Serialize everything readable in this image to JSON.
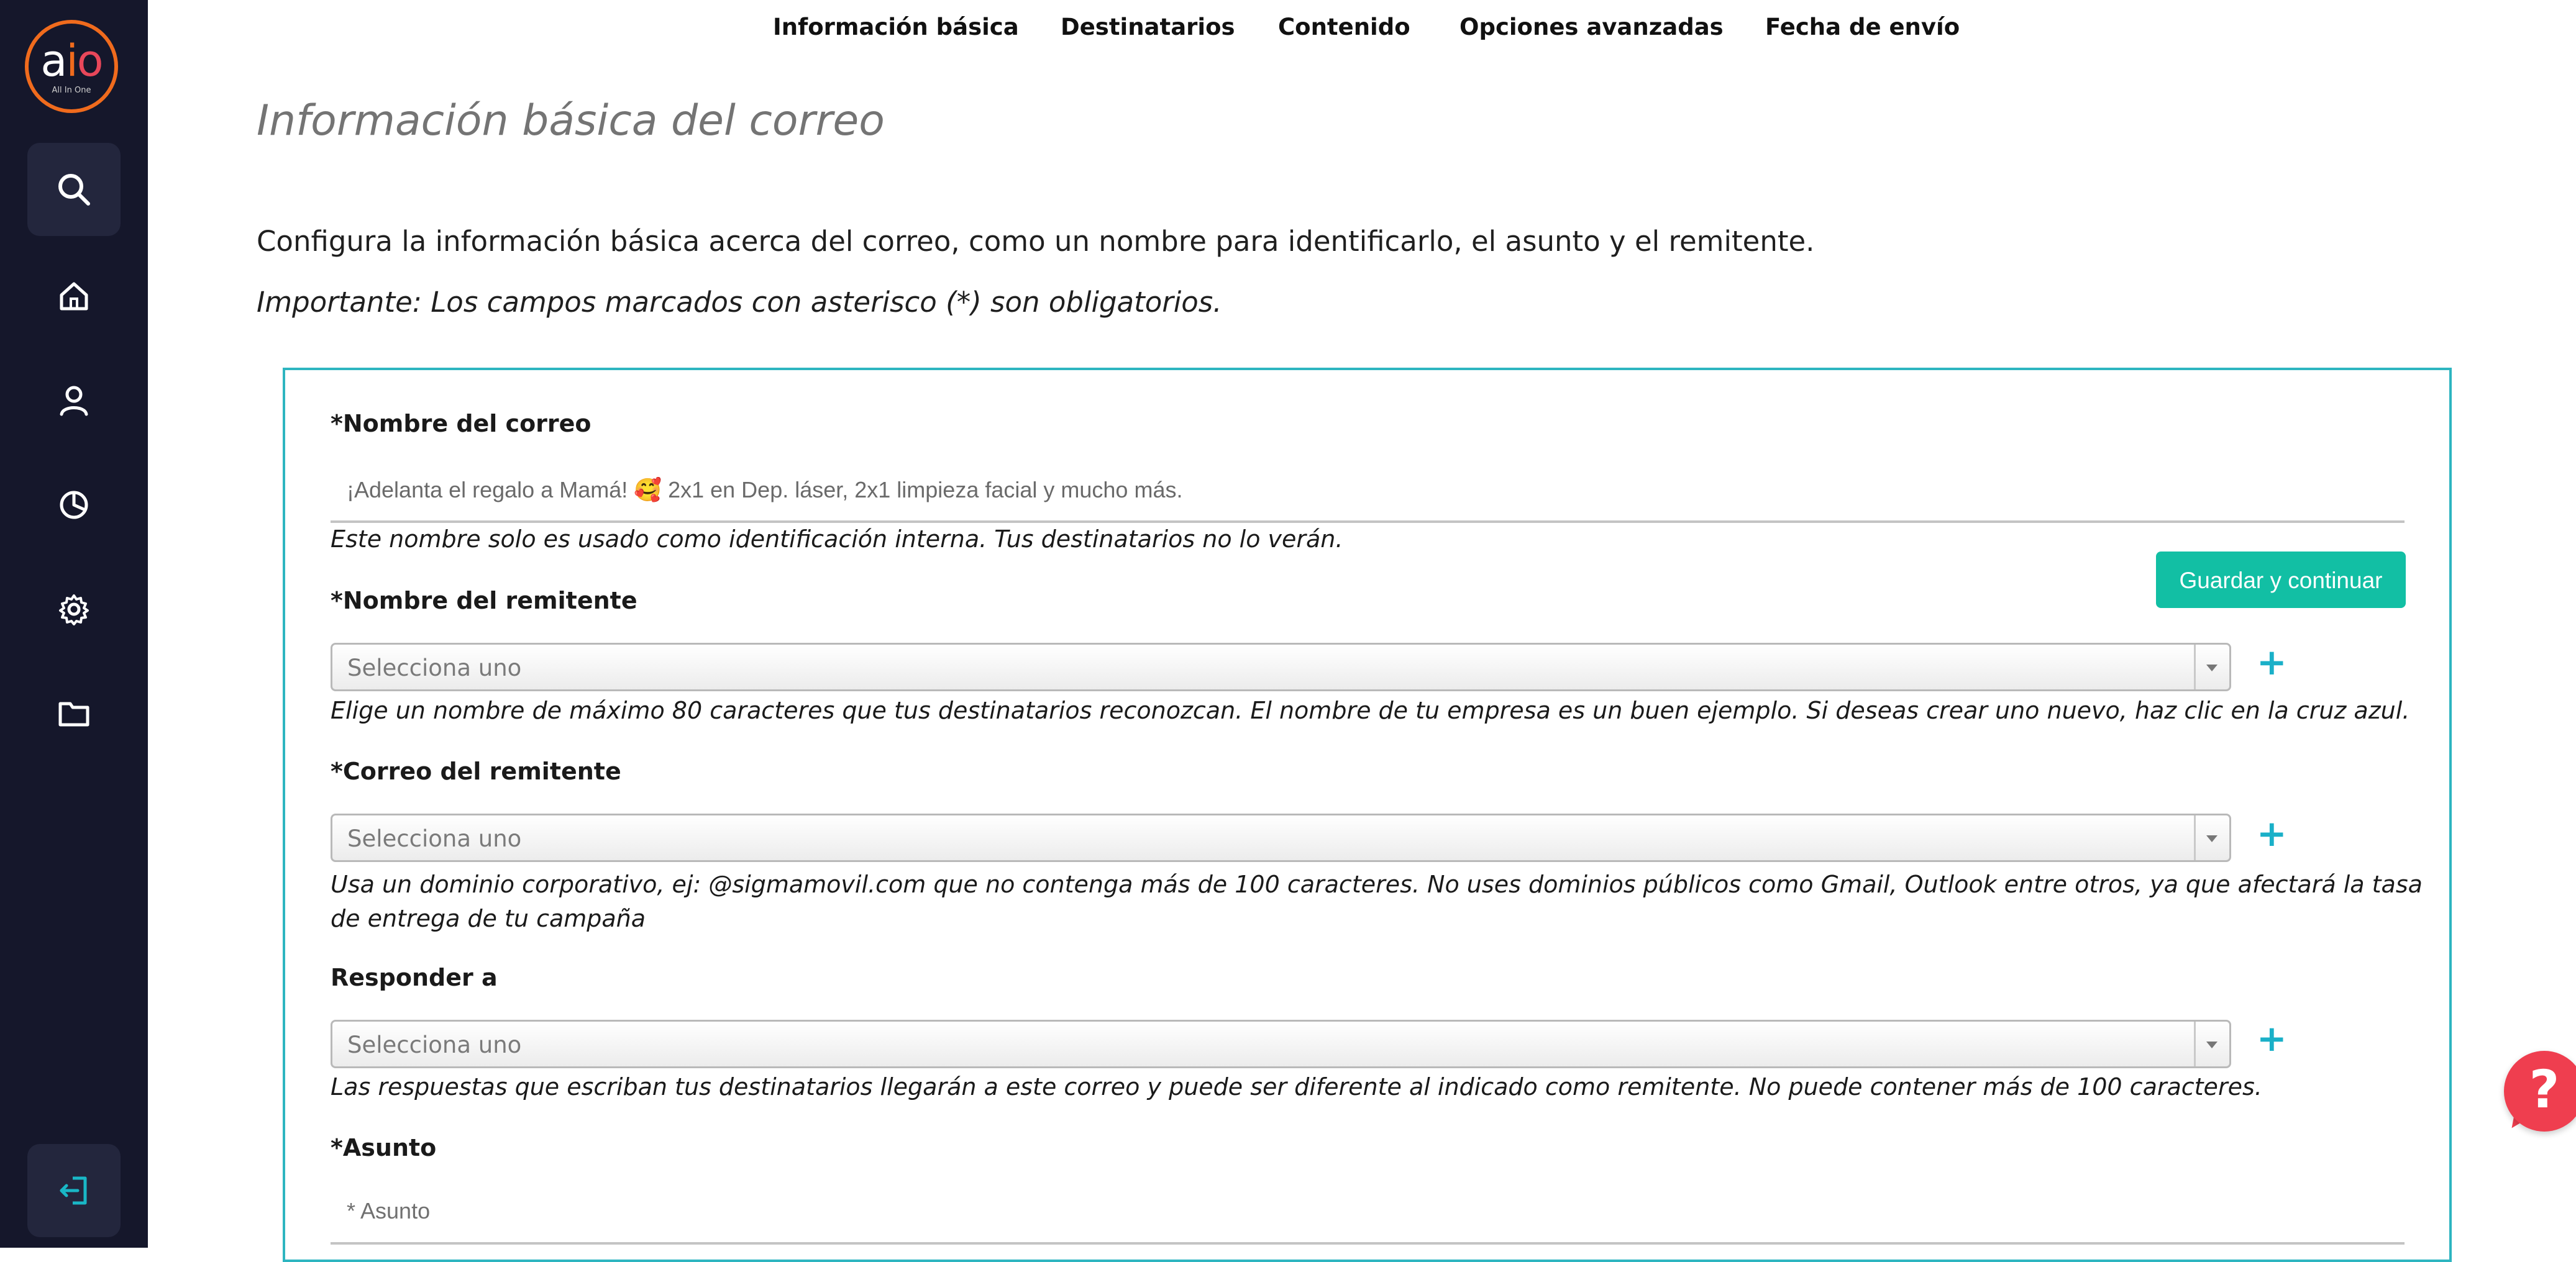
{
  "app": {
    "logo_text": "aio",
    "logo_subtitle": "All In One"
  },
  "colors": {
    "sidebar_bg": "#15172b",
    "accent_teal": "#12bfa4",
    "card_border": "#2eb5c0",
    "plus_blue": "#1ab0c8",
    "help_red": "#ef3e4f",
    "logo_orange": "#f06b1d"
  },
  "sidebar": {
    "items": [
      {
        "name": "search",
        "icon": "search-icon"
      },
      {
        "name": "home",
        "icon": "home-icon"
      },
      {
        "name": "contacts",
        "icon": "user-icon"
      },
      {
        "name": "reports",
        "icon": "pie-chart-icon"
      },
      {
        "name": "settings",
        "icon": "gear-icon"
      },
      {
        "name": "files",
        "icon": "folder-icon"
      }
    ],
    "exit": {
      "icon": "logout-icon"
    }
  },
  "nav": {
    "tabs": [
      {
        "label": "Información básica"
      },
      {
        "label": "Destinatarios"
      },
      {
        "label": "Contenido"
      },
      {
        "label": "Opciones avanzadas"
      },
      {
        "label": "Fecha de envío"
      }
    ]
  },
  "page": {
    "title": "Información básica del correo",
    "intro": "Configura la información básica acerca del correo, como un nombre para identificarlo, el asunto y el remitente.",
    "important": "Importante: Los campos marcados con asterisco (*) son obligatorios."
  },
  "form": {
    "email_name": {
      "label": "*Nombre del correo",
      "value": "¡Adelanta el regalo a Mamá! 🥰 2x1 en Dep. láser, 2x1 limpieza facial y mucho más.",
      "help": "Este nombre solo es usado como identificación interna. Tus destinatarios no lo verán."
    },
    "sender_name": {
      "label": "*Nombre del remitente",
      "selected": "Selecciona uno",
      "help": "Elige un nombre de máximo 80 caracteres que tus destinatarios reconozcan. El nombre de tu empresa es un buen ejemplo. Si deseas crear uno nuevo, haz clic en la cruz azul."
    },
    "sender_email": {
      "label": "*Correo del remitente",
      "selected": "Selecciona uno",
      "help": "Usa un dominio corporativo, ej: @sigmamovil.com que no contenga más de 100 caracteres. No uses dominios públicos como Gmail, Outlook entre otros, ya que afectará la tasa de entrega de tu campaña"
    },
    "reply_to": {
      "label": "Responder a",
      "selected": "Selecciona uno",
      "help": "Las respuestas que escriban tus destinatarios llegarán a este correo y puede ser diferente al indicado como remitente. No puede contener más de 100 caracteres."
    },
    "subject": {
      "label": "*Asunto",
      "placeholder": "* Asunto"
    },
    "add_symbol": "+",
    "save_label": "Guardar y continuar"
  },
  "help_button": {
    "label": "?"
  }
}
